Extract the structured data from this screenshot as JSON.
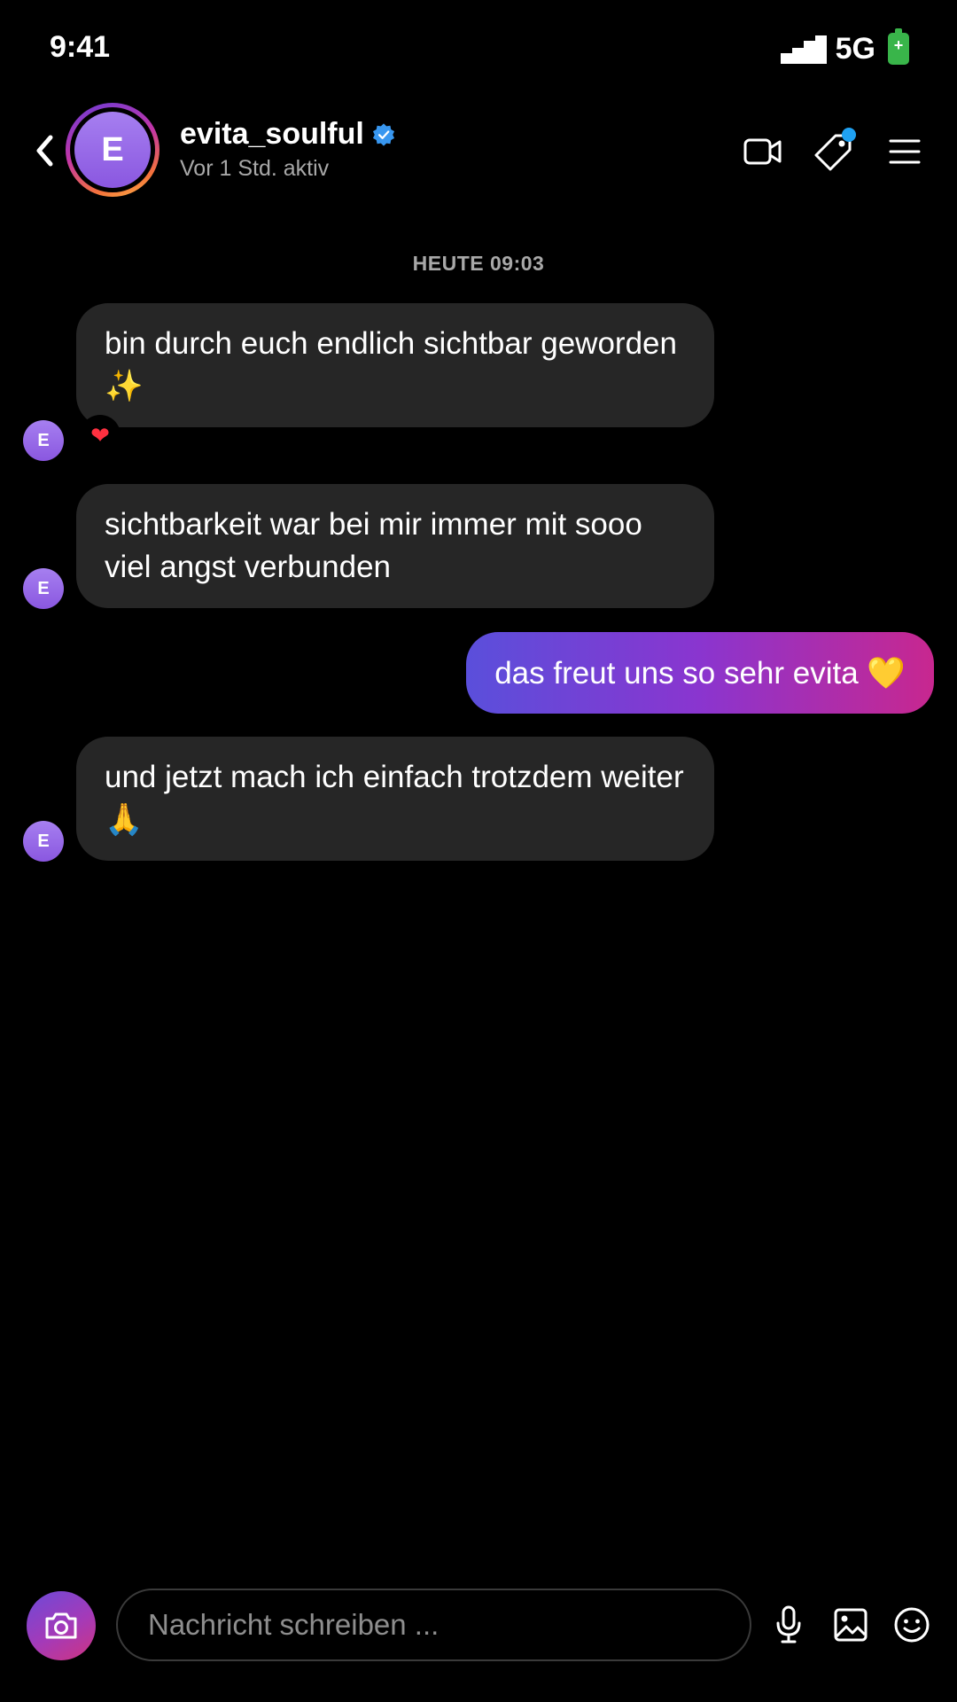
{
  "status_bar": {
    "time": "9:41",
    "network": "5G",
    "icons": [
      "signal-icon",
      "battery-icon"
    ]
  },
  "header": {
    "avatar_initial": "E",
    "username": "evita_soulful",
    "verified": true,
    "activity": "Vor 1 Std. aktiv",
    "actions": [
      "video-call-icon",
      "tag-icon",
      "menu-icon"
    ],
    "accent_color": "#1fa1f2"
  },
  "conversation": {
    "date_divider": "HEUTE 09:03",
    "messages": [
      {
        "from": "contact",
        "avatar_initial": "E",
        "text": "bin durch euch endlich sichtbar geworden ✨",
        "reaction": "❤"
      },
      {
        "from": "contact",
        "avatar_initial": "E",
        "text": "sichtbarkeit war bei mir immer mit sooo viel angst verbunden"
      },
      {
        "from": "me",
        "text": "das freut uns so sehr evita 💛"
      },
      {
        "from": "contact",
        "avatar_initial": "E",
        "text": "und jetzt mach ich einfach trotzdem weiter 🙏"
      }
    ]
  },
  "composer": {
    "placeholder": "Nachricht schreiben ...",
    "value": "",
    "icons": [
      "camera-icon",
      "microphone-icon",
      "gallery-icon",
      "sticker-icon"
    ]
  },
  "colors": {
    "background": "#000000",
    "incoming_bubble": "#262626",
    "outgoing_gradient": [
      "#5a4fdb",
      "#8a35cf",
      "#c8278f"
    ],
    "reaction_heart": "#ff3040",
    "secondary_text": "#a8a8a8"
  }
}
